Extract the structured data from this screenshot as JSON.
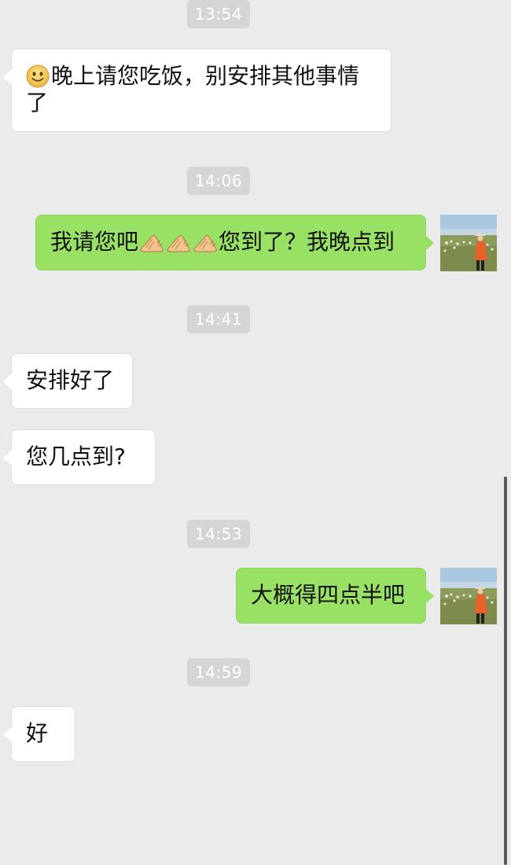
{
  "chat": {
    "messages": [
      {
        "type": "time",
        "text": "13:54"
      },
      {
        "type": "incoming",
        "emoji": "smile-emoji",
        "text": "晚上请您吃饭，别安排其他事情了"
      },
      {
        "type": "time",
        "text": "14:06"
      },
      {
        "type": "outgoing",
        "text_before": "我请您吧",
        "emoji": "clap-hands-emoji",
        "emoji_count": 3,
        "text_after": "您到了？我晚点到"
      },
      {
        "type": "time",
        "text": "14:41"
      },
      {
        "type": "incoming",
        "text": "安排好了"
      },
      {
        "type": "incoming",
        "text": "您几点到?"
      },
      {
        "type": "time",
        "text": "14:53"
      },
      {
        "type": "outgoing",
        "text": "大概得四点半吧"
      },
      {
        "type": "time",
        "text": "14:59"
      },
      {
        "type": "incoming",
        "text": "好"
      }
    ],
    "colors": {
      "background": "#ebebeb",
      "incoming_bubble": "#ffffff",
      "outgoing_bubble": "#98e165",
      "timestamp_bg": "#d5d5d5",
      "timestamp_text": "#ffffff"
    }
  }
}
